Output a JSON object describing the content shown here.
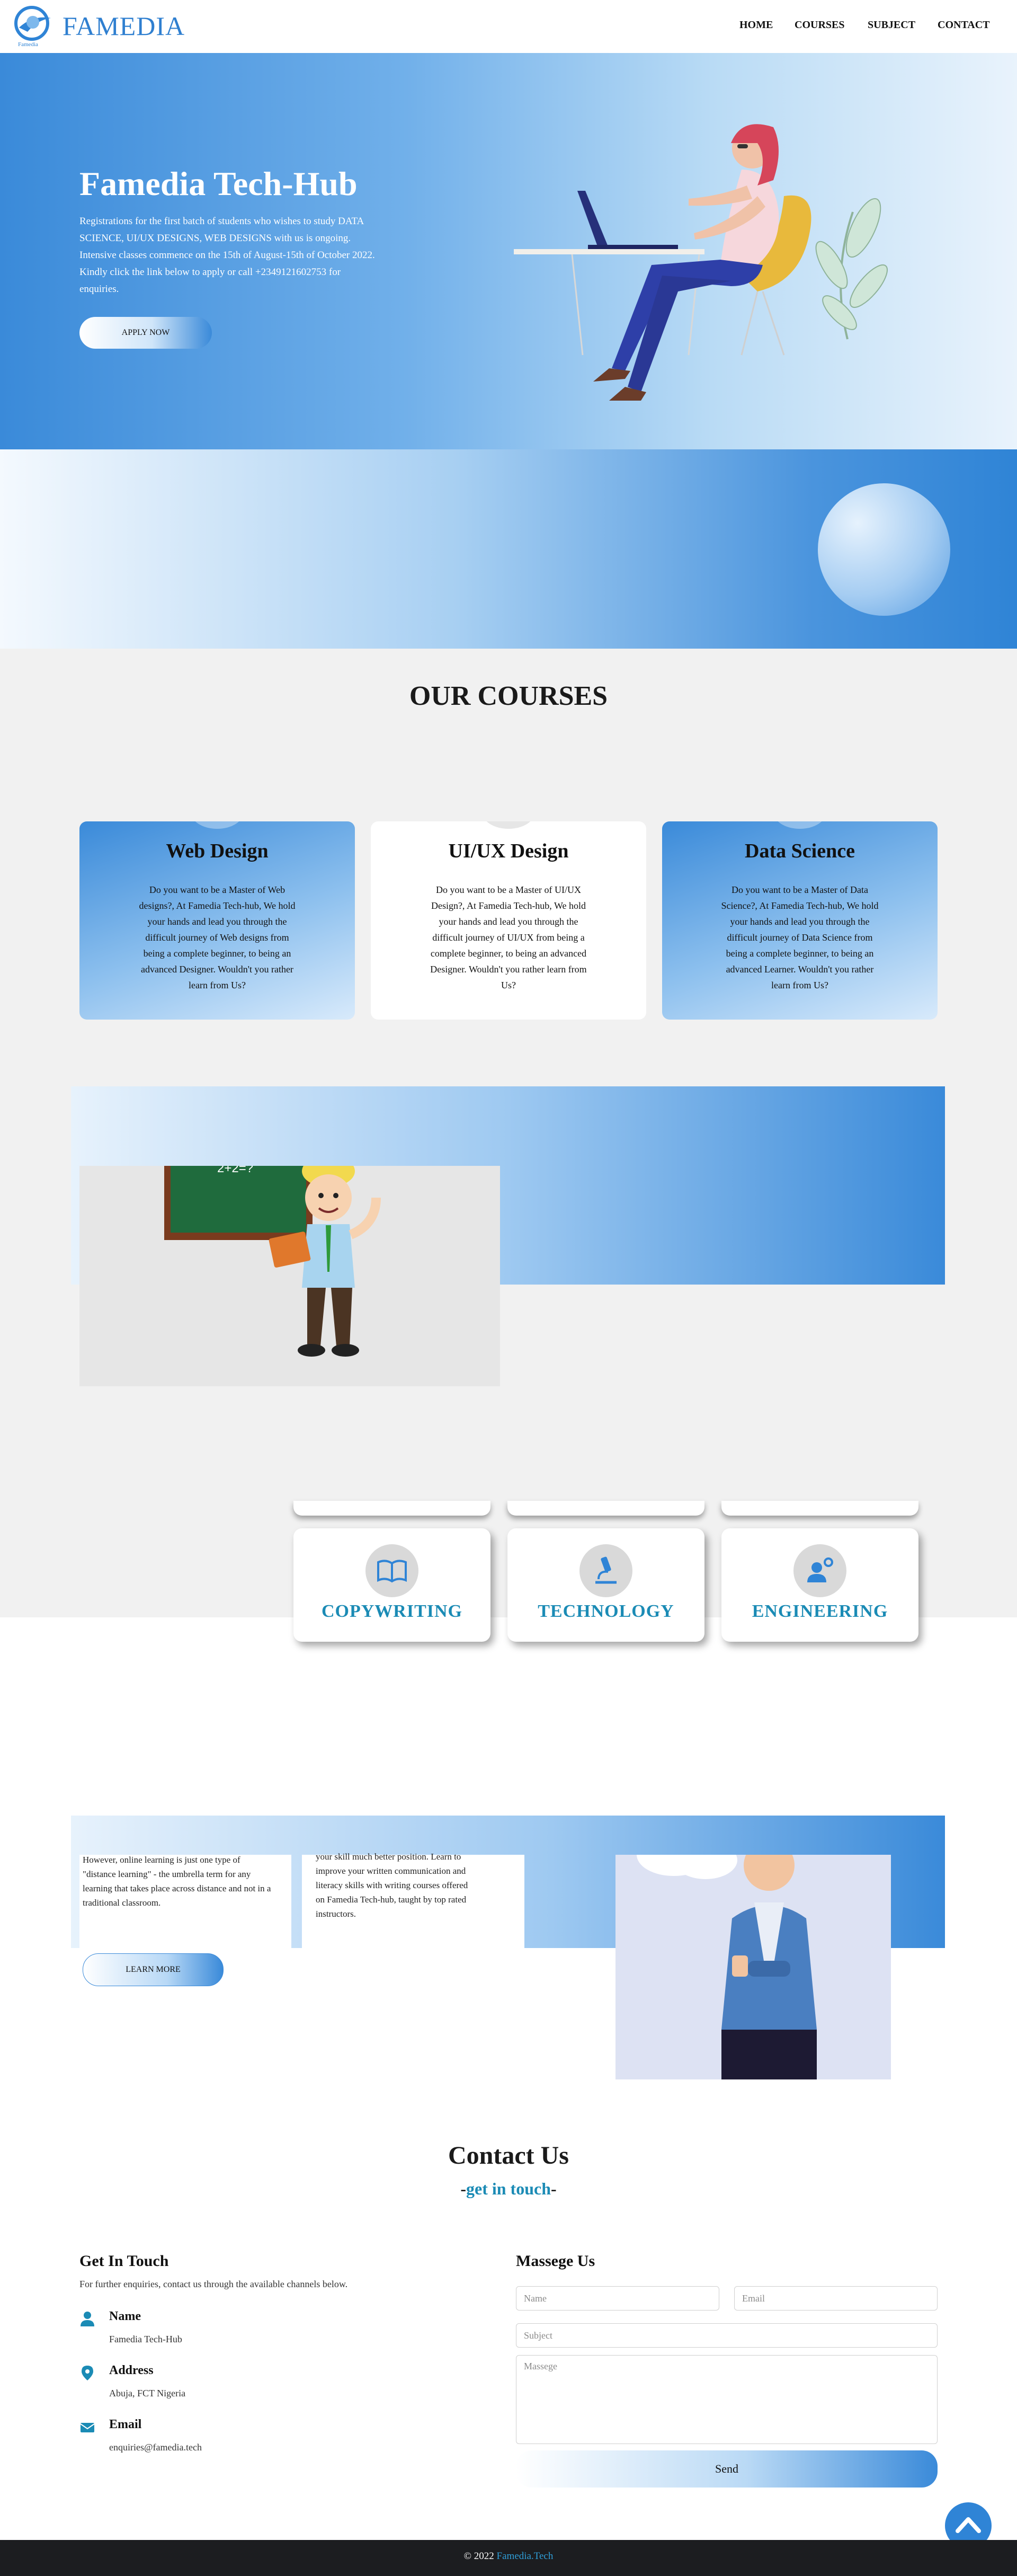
{
  "header": {
    "logo_text": "FAMEDIA",
    "logo_subtext": "Famedia",
    "nav": [
      "HOME",
      "COURSES",
      "SUBJECT",
      "CONTACT"
    ]
  },
  "hero": {
    "title": "Famedia Tech-Hub",
    "text": "Registrations for the first batch of students who wishes to study DATA SCIENCE, UI/UX DESIGNS, WEB DESIGNS with us is ongoing. Intensive classes commence on the 15th of August-15th of October 2022. Kindly click the link below to apply or call +2349121602753 for enquiries.",
    "button": "APPLY NOW"
  },
  "courses": {
    "title": "OUR COURSES",
    "cards": [
      {
        "title": "Web Design",
        "text": "Do you want to be a Master of Web designs?, At Famedia Tech-hub, We hold your hands and lead you through the difficult journey of Web designs from being a complete beginner, to being an advanced Designer. Wouldn't you rather learn from Us?"
      },
      {
        "title": "UI/UX Design",
        "text": "Do you want to be a Master of UI/UX Design?, At Famedia Tech-hub, We hold your hands and lead you through the difficult journey of UI/UX from being a complete beginner, to being an advanced Designer. Wouldn't you rather learn from Us?"
      },
      {
        "title": "Data Science",
        "text": "Do you want to be a Master of Data Science?, At Famedia Tech-hub, We hold your hands and lead you through the difficult journey of Data Science from being a complete beginner, to being an advanced Learner. Wouldn't you rather learn from Us?"
      }
    ]
  },
  "promo": {
    "board_text": "2+2=?"
  },
  "subjects": [
    {
      "label": "COPYWRITING",
      "icon": "book-icon"
    },
    {
      "label": "TECHNOLOGY",
      "icon": "microscope-icon"
    },
    {
      "label": "ENGINEERING",
      "icon": "engineer-icon"
    }
  ],
  "learning": {
    "text1": "However, online learning is just one type of \"distance learning\" - the umbrella term for any learning that takes place across distance and not in a traditional classroom.",
    "text2": "your skill much better position. Learn to improve your written communication and literacy skills with writing courses offered on Famedia Tech-hub, taught by top rated instructors.",
    "button": "LEARN MORE"
  },
  "contact": {
    "title": "Contact Us",
    "subtitle": "get in touch",
    "get_in_touch": {
      "heading": "Get In Touch",
      "text": "For further enquiries, contact us through the available channels below.",
      "items": [
        {
          "title": "Name",
          "value": "Famedia Tech-Hub",
          "icon": "person-icon"
        },
        {
          "title": "Address",
          "value": "Abuja, FCT Nigeria",
          "icon": "location-icon"
        },
        {
          "title": "Email",
          "value": "enquiries@famedia.tech",
          "icon": "mail-icon"
        }
      ]
    },
    "form": {
      "heading": "Massege Us",
      "name_placeholder": "Name",
      "email_placeholder": "Email",
      "subject_placeholder": "Subject",
      "message_placeholder": "Massege",
      "send": "Send"
    }
  },
  "footer": {
    "year": "2022",
    "brand": "Famedia.Tech"
  },
  "colors": {
    "accent": "#2f84d6",
    "teal": "#1b8bb5",
    "footer": "#1c1d20"
  }
}
